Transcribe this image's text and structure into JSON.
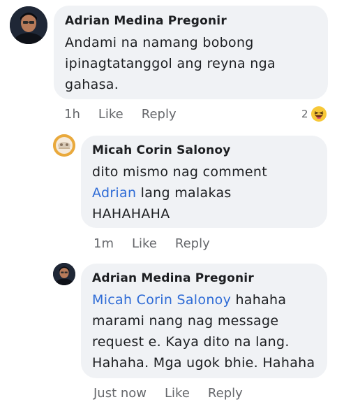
{
  "comments": [
    {
      "author": "Adrian Medina Pregonir",
      "text": "Andami na namang bobong ipinagtatanggol ang reyna nga gahasa.",
      "time": "1h",
      "like": "Like",
      "reply": "Reply",
      "reaction_count": "2",
      "reaction_icon": "laughing-face-emoji"
    },
    {
      "author": "Micah Corin Salonoy",
      "text_before": "dito mismo nag comment",
      "mention": "Adrian",
      "text_after": "lang malakas",
      "text_end": "HAHAHAHA",
      "time": "1m",
      "like": "Like",
      "reply": "Reply"
    },
    {
      "author": "Adrian Medina Pregonir",
      "mention": "Micah Corin Salonoy",
      "text_after": "hahaha marami nang nag message request e. Kaya dito na lang. Hahaha. Mga ugok bhie. Hahaha",
      "time": "Just now",
      "like": "Like",
      "reply": "Reply"
    }
  ],
  "colors": {
    "bubble": "#f0f2f5",
    "mention": "#2e6bd6",
    "meta": "#65676b"
  }
}
